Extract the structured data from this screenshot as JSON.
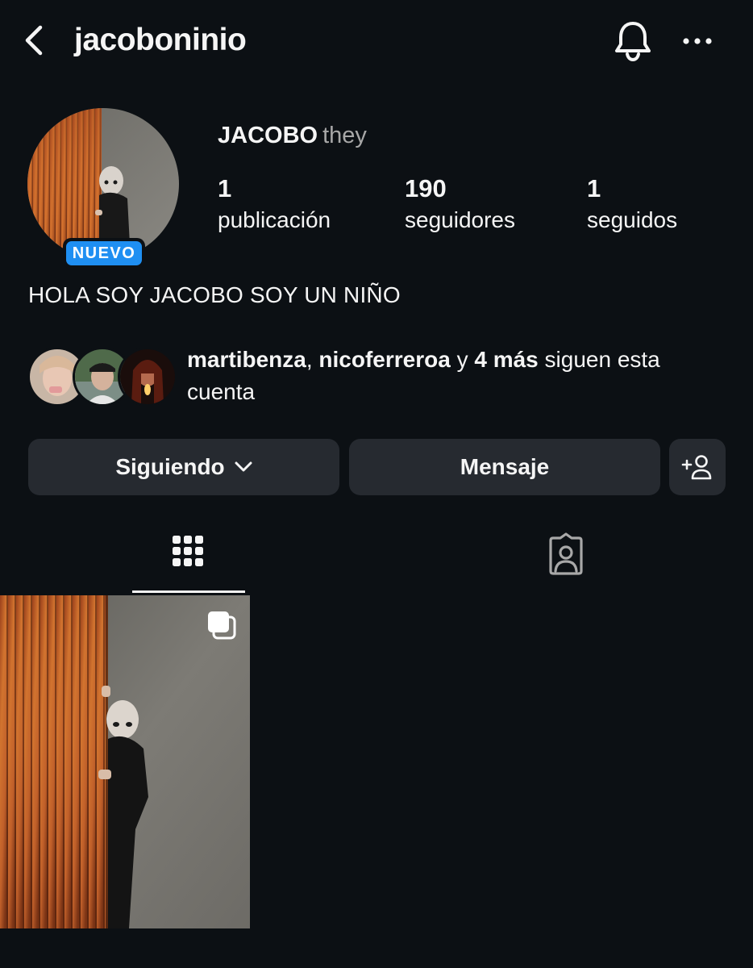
{
  "header": {
    "username": "jacoboninio",
    "back_icon": "chevron-left-icon",
    "bell_icon": "bell-icon",
    "more_icon": "more-horizontal-icon"
  },
  "profile": {
    "display_name": "JACOBO",
    "pronouns": "they",
    "badge": "NUEVO",
    "bio": "HOLA SOY JACOBO SOY UN NIÑO",
    "stats": [
      {
        "value": "1",
        "label": "publicación"
      },
      {
        "value": "190",
        "label": "seguidores"
      },
      {
        "value": "1",
        "label": "seguidos"
      }
    ]
  },
  "followed_by": {
    "user1": "martibenza",
    "separator": ", ",
    "user2": "nicoferreroa",
    "connector": " y ",
    "more": "4 más",
    "suffix": " siguen esta cuenta"
  },
  "actions": {
    "following_label": "Siguiendo",
    "message_label": "Mensaje",
    "add_icon": "person-add-icon"
  },
  "tabs": [
    {
      "name": "posts-grid",
      "icon": "grid-icon",
      "active": true
    },
    {
      "name": "tagged",
      "icon": "tagged-person-icon",
      "active": false
    }
  ],
  "colors": {
    "background": "#0c1014",
    "button": "#262a30",
    "badge": "#1f8ff2",
    "muted_text": "#a8a8a8"
  }
}
